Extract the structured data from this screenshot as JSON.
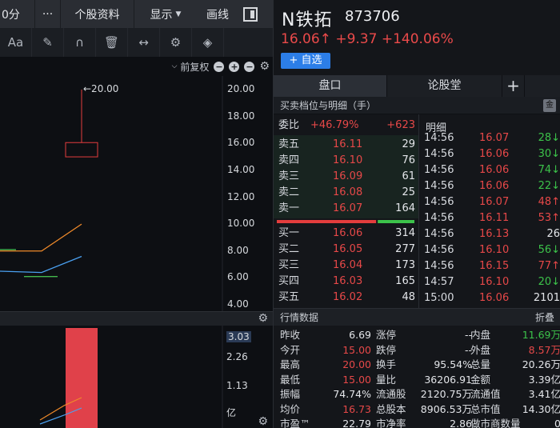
{
  "left": {
    "toolbar": {
      "period": "0分",
      "more": "···",
      "profile": "个股资料",
      "display": "显示",
      "draw": "画线"
    },
    "tools": [
      "Aa",
      "✎",
      "∩",
      "🗑",
      "↔",
      "⚙",
      "◈"
    ],
    "adjust_label": "前复权",
    "price_axis": [
      "20.00",
      "18.00",
      "16.00",
      "14.00",
      "12.00",
      "10.00",
      "8.00",
      "6.00",
      "4.00"
    ],
    "volume_axis": [
      "3.03",
      "2.26",
      "1.13",
      "亿"
    ],
    "annotation": "←20.00"
  },
  "chart_data": {
    "type": "bar",
    "ylim": [
      4,
      20
    ],
    "price_axis": [
      20,
      18,
      16,
      14,
      12,
      10,
      8,
      6,
      4
    ],
    "candle": {
      "open": 15.0,
      "close": 16.06,
      "high": 20.0,
      "low": 15.0
    },
    "annotation_value": 20.0,
    "ma_lines": [
      {
        "color": "#f08a2a",
        "values": [
          8.0,
          8.0,
          10.0
        ]
      },
      {
        "color": "#4aa0f0",
        "values": [
          6.5,
          6.4,
          7.6
        ]
      }
    ],
    "short_lines": [
      {
        "color": "#44b84c",
        "value": 8.1
      },
      {
        "color": "#44b84c",
        "value": 6.1
      }
    ],
    "volume": {
      "value": 3.03,
      "ylim": [
        0,
        3.03
      ]
    }
  },
  "right": {
    "name": "N铁拓",
    "code": "873706",
    "price": "16.06↑",
    "change": "+9.37",
    "pct": "+140.06%",
    "add_btn": "+ 自选",
    "tabs": [
      "盘口",
      "论股堂",
      "+"
    ],
    "section_title": "买卖档位与明细（手）",
    "badge": "金",
    "weibi": {
      "label": "委比",
      "pct": "+46.79%",
      "diff": "+623"
    },
    "sells": [
      {
        "label": "卖五",
        "price": "16.11",
        "vol": "29"
      },
      {
        "label": "卖四",
        "price": "16.10",
        "vol": "76"
      },
      {
        "label": "卖三",
        "price": "16.09",
        "vol": "61"
      },
      {
        "label": "卖二",
        "price": "16.08",
        "vol": "25"
      },
      {
        "label": "卖一",
        "price": "16.07",
        "vol": "164"
      }
    ],
    "buys": [
      {
        "label": "买一",
        "price": "16.06",
        "vol": "314"
      },
      {
        "label": "买二",
        "price": "16.05",
        "vol": "277"
      },
      {
        "label": "买三",
        "price": "16.04",
        "vol": "173"
      },
      {
        "label": "买四",
        "price": "16.03",
        "vol": "165"
      },
      {
        "label": "买五",
        "price": "16.02",
        "vol": "48"
      }
    ],
    "ticks_title": "明细",
    "ticks": [
      {
        "time": "14:56",
        "price": "16.07",
        "vol": "28↓",
        "color": "green"
      },
      {
        "time": "14:56",
        "price": "16.06",
        "vol": "30↓",
        "color": "green"
      },
      {
        "time": "14:56",
        "price": "16.06",
        "vol": "74↓",
        "color": "green"
      },
      {
        "time": "14:56",
        "price": "16.06",
        "vol": "22↓",
        "color": "green"
      },
      {
        "time": "14:56",
        "price": "16.07",
        "vol": "48↑",
        "color": "red"
      },
      {
        "time": "14:56",
        "price": "16.11",
        "vol": "53↑",
        "color": "red"
      },
      {
        "time": "14:56",
        "price": "16.13",
        "vol": "26",
        "color": "white"
      },
      {
        "time": "14:56",
        "price": "16.10",
        "vol": "56↓",
        "color": "green"
      },
      {
        "time": "14:56",
        "price": "16.15",
        "vol": "77↑",
        "color": "red"
      },
      {
        "time": "14:57",
        "price": "16.10",
        "vol": "20↓",
        "color": "green"
      },
      {
        "time": "15:00",
        "price": "16.06",
        "vol": "2101",
        "color": "white"
      }
    ],
    "quote_title": "行情数据",
    "fold": "折叠",
    "quote": [
      [
        {
          "l": "昨收",
          "v": "6.69",
          "c": "white"
        },
        {
          "l": "涨停",
          "v": "--",
          "c": "white"
        },
        {
          "l": "内盘",
          "v": "11.69万",
          "c": "green"
        }
      ],
      [
        {
          "l": "今开",
          "v": "15.00",
          "c": "red"
        },
        {
          "l": "跌停",
          "v": "--",
          "c": "white"
        },
        {
          "l": "外盘",
          "v": "8.57万",
          "c": "red"
        }
      ],
      [
        {
          "l": "最高",
          "v": "20.00",
          "c": "red"
        },
        {
          "l": "换手",
          "v": "95.54%",
          "c": "white"
        },
        {
          "l": "总量",
          "v": "20.26万",
          "c": "white"
        }
      ],
      [
        {
          "l": "最低",
          "v": "15.00",
          "c": "red"
        },
        {
          "l": "量比",
          "v": "36206.91",
          "c": "white"
        },
        {
          "l": "金额",
          "v": "3.39亿",
          "c": "white"
        }
      ],
      [
        {
          "l": "振幅",
          "v": "74.74%",
          "c": "white"
        },
        {
          "l": "流通股",
          "v": "2120.75万",
          "c": "white"
        },
        {
          "l": "流通值",
          "v": "3.41亿",
          "c": "white"
        }
      ],
      [
        {
          "l": "均价",
          "v": "16.73",
          "c": "red"
        },
        {
          "l": "总股本",
          "v": "8906.53万",
          "c": "white"
        },
        {
          "l": "总市值",
          "v": "14.30亿",
          "c": "white"
        }
      ],
      [
        {
          "l": "市盈™",
          "v": "22.79",
          "c": "white"
        },
        {
          "l": "市净率",
          "v": "2.86",
          "c": "white"
        },
        {
          "l": "做市商数量",
          "v": "0",
          "c": "white"
        }
      ]
    ]
  }
}
